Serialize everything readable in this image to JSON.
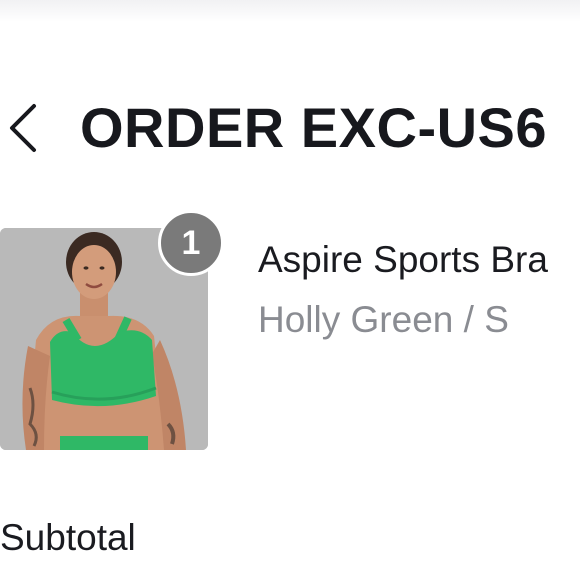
{
  "header": {
    "back_icon": "chevron-left-icon",
    "title": "ORDER EXC-US6"
  },
  "line_item": {
    "quantity": "1",
    "product_name": "Aspire Sports Bra",
    "variant": "Holly Green / S",
    "image_desc_color": "#2fb866"
  },
  "summary": {
    "subtotal_label": "Subtotal"
  },
  "colors": {
    "text": "#17181d",
    "muted": "#8a8c92",
    "badge": "#7a7a7a",
    "photo_bg": "#b8b8b8",
    "garment": "#2fb866"
  }
}
